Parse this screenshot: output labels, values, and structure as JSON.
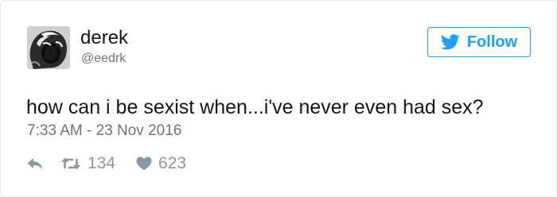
{
  "user": {
    "display_name": "derek",
    "handle": "@eedrk",
    "avatar_icon": "screaming-face-avatar"
  },
  "follow_button": {
    "label": "Follow",
    "icon": "twitter-bird-icon",
    "color": "#1da1f2"
  },
  "tweet": {
    "text": "how can i be sexist when...i've never even had sex?",
    "timestamp": "7:33 AM - 23 Nov 2016"
  },
  "actions": {
    "reply_icon": "reply-icon",
    "retweet_icon": "retweet-icon",
    "retweet_count": "134",
    "like_icon": "heart-icon",
    "like_count": "623"
  },
  "colors": {
    "text_primary": "#14171a",
    "text_secondary": "#657786",
    "action_gray": "#8899a6",
    "border": "#e1e8ed"
  }
}
